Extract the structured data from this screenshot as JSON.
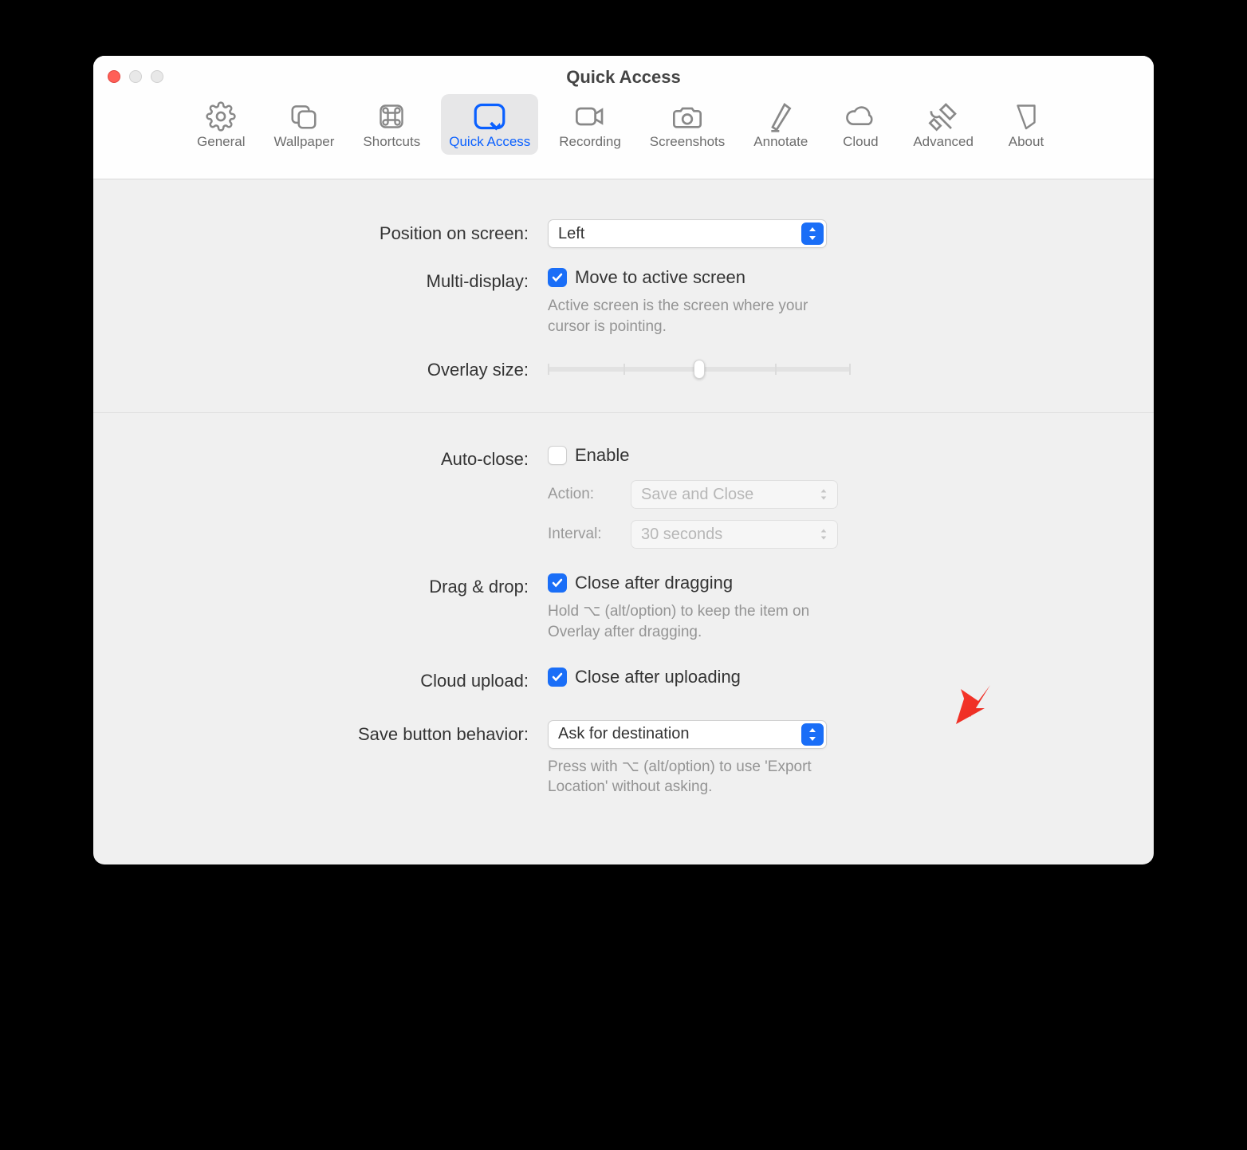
{
  "window": {
    "title": "Quick Access"
  },
  "tabs": [
    {
      "label": "General"
    },
    {
      "label": "Wallpaper"
    },
    {
      "label": "Shortcuts"
    },
    {
      "label": "Quick Access"
    },
    {
      "label": "Recording"
    },
    {
      "label": "Screenshots"
    },
    {
      "label": "Annotate"
    },
    {
      "label": "Cloud"
    },
    {
      "label": "Advanced"
    },
    {
      "label": "About"
    }
  ],
  "settings": {
    "position": {
      "label": "Position on screen:",
      "value": "Left"
    },
    "multi_display": {
      "label": "Multi-display:",
      "checkbox_label": "Move to active screen",
      "checked": true,
      "help": "Active screen is the screen where your cursor is pointing."
    },
    "overlay_size": {
      "label": "Overlay size:",
      "value_percent": 50
    },
    "auto_close": {
      "label": "Auto-close:",
      "checkbox_label": "Enable",
      "checked": false,
      "action_label": "Action:",
      "action_value": "Save and Close",
      "interval_label": "Interval:",
      "interval_value": "30 seconds"
    },
    "drag_drop": {
      "label": "Drag & drop:",
      "checkbox_label": "Close after dragging",
      "checked": true,
      "help": "Hold ⌥ (alt/option) to keep the item on Overlay after dragging."
    },
    "cloud_upload": {
      "label": "Cloud upload:",
      "checkbox_label": "Close after uploading",
      "checked": true
    },
    "save_button": {
      "label": "Save button behavior:",
      "value": "Ask for destination",
      "help": "Press with ⌥ (alt/option) to use 'Export Location' without asking."
    }
  }
}
